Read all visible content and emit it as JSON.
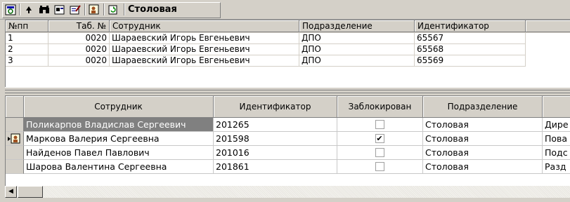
{
  "toolbar": {
    "title": "Столовая",
    "buttons": [
      "view-icon",
      "pin-icon",
      "binoculars-icon",
      "find-card-icon",
      "edit-card-icon",
      "person-card-icon",
      "refresh-icon"
    ]
  },
  "grid_top": {
    "columns": [
      "№пп",
      "Таб. №",
      "Сотрудник",
      "Подразделение",
      "Идентификатор"
    ],
    "rows": [
      [
        "1",
        "0020",
        "Шараевский Игорь Евгеньевич",
        "ДПО",
        "65567"
      ],
      [
        "2",
        "0020",
        "Шараевский Игорь Евгеньевич",
        "ДПО",
        "65568"
      ],
      [
        "3",
        "0020",
        "Шараевский Игорь Евгеньевич",
        "ДПО",
        "65569"
      ]
    ]
  },
  "grid_bottom": {
    "columns": [
      "Сотрудник",
      "Идентификатор",
      "Заблокирован",
      "Подразделение",
      ""
    ],
    "rows": [
      {
        "name": "Поликарпов Владислав Сергеевич",
        "id": "201265",
        "blocked": "",
        "dept": "Столовая",
        "extra": "Дире"
      },
      {
        "name": "Маркова Валерия Сергеевна",
        "id": "201598",
        "blocked": "✔",
        "dept": "Столовая",
        "extra": "Пова"
      },
      {
        "name": "Найденов Павел Павлович",
        "id": "201016",
        "blocked": "",
        "dept": "Столовая",
        "extra": "Подс"
      },
      {
        "name": "Шарова Валентина Сергеевна",
        "id": "201861",
        "blocked": "",
        "dept": "Столовая",
        "extra": "Разд"
      }
    ]
  },
  "scroll": {
    "left_arrow": "◀"
  }
}
